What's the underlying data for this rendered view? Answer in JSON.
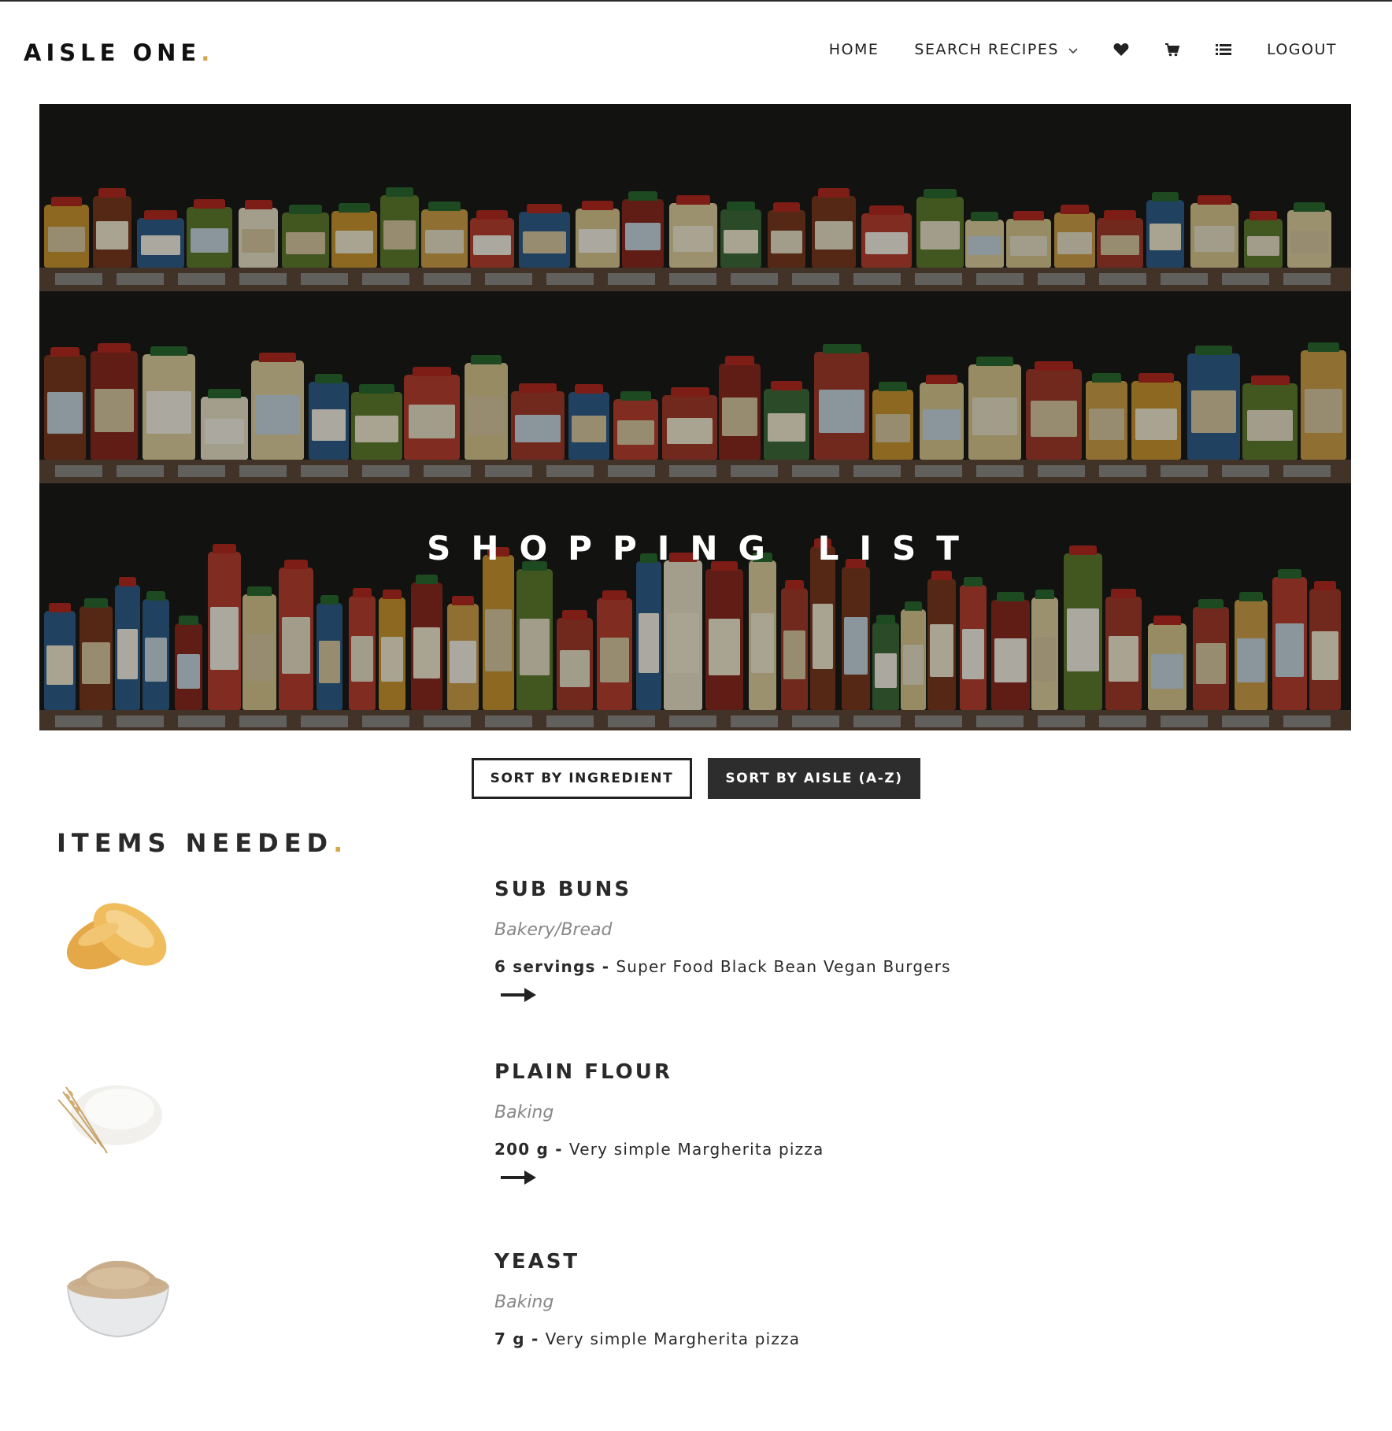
{
  "header": {
    "logo_text": "AISLE ONE",
    "logo_dot": ".",
    "nav": {
      "home": "HOME",
      "search_recipes": "SEARCH RECIPES",
      "logout": "LOGOUT"
    },
    "icons": [
      "heart-icon",
      "cart-icon",
      "list-icon",
      "chevron-down-icon"
    ]
  },
  "hero": {
    "title": "SHOPPING LIST"
  },
  "sort": {
    "by_ingredient": "SORT BY INGREDIENT",
    "by_aisle": "SORT BY AISLE (A-Z)"
  },
  "items_heading": {
    "text": "ITEMS NEEDED",
    "dot": "."
  },
  "items": [
    {
      "name": "SUB BUNS",
      "aisle": "Bakery/Bread",
      "amount": "6 servings",
      "separator": " - ",
      "recipe": "Super Food Black Bean Vegan Burgers",
      "image": "sub-buns"
    },
    {
      "name": "PLAIN FLOUR",
      "aisle": "Baking",
      "amount": "200 g",
      "separator": " - ",
      "recipe": "Very simple Margherita pizza",
      "image": "flour"
    },
    {
      "name": "YEAST",
      "aisle": "Baking",
      "amount": "7 g",
      "separator": " - ",
      "recipe": "Very simple Margherita pizza",
      "image": "yeast"
    }
  ],
  "colors": {
    "accent_dot": "#d6a64a",
    "dark_button": "#2d2d2d",
    "text": "#2a2a2a",
    "aisle_text": "#888888"
  }
}
